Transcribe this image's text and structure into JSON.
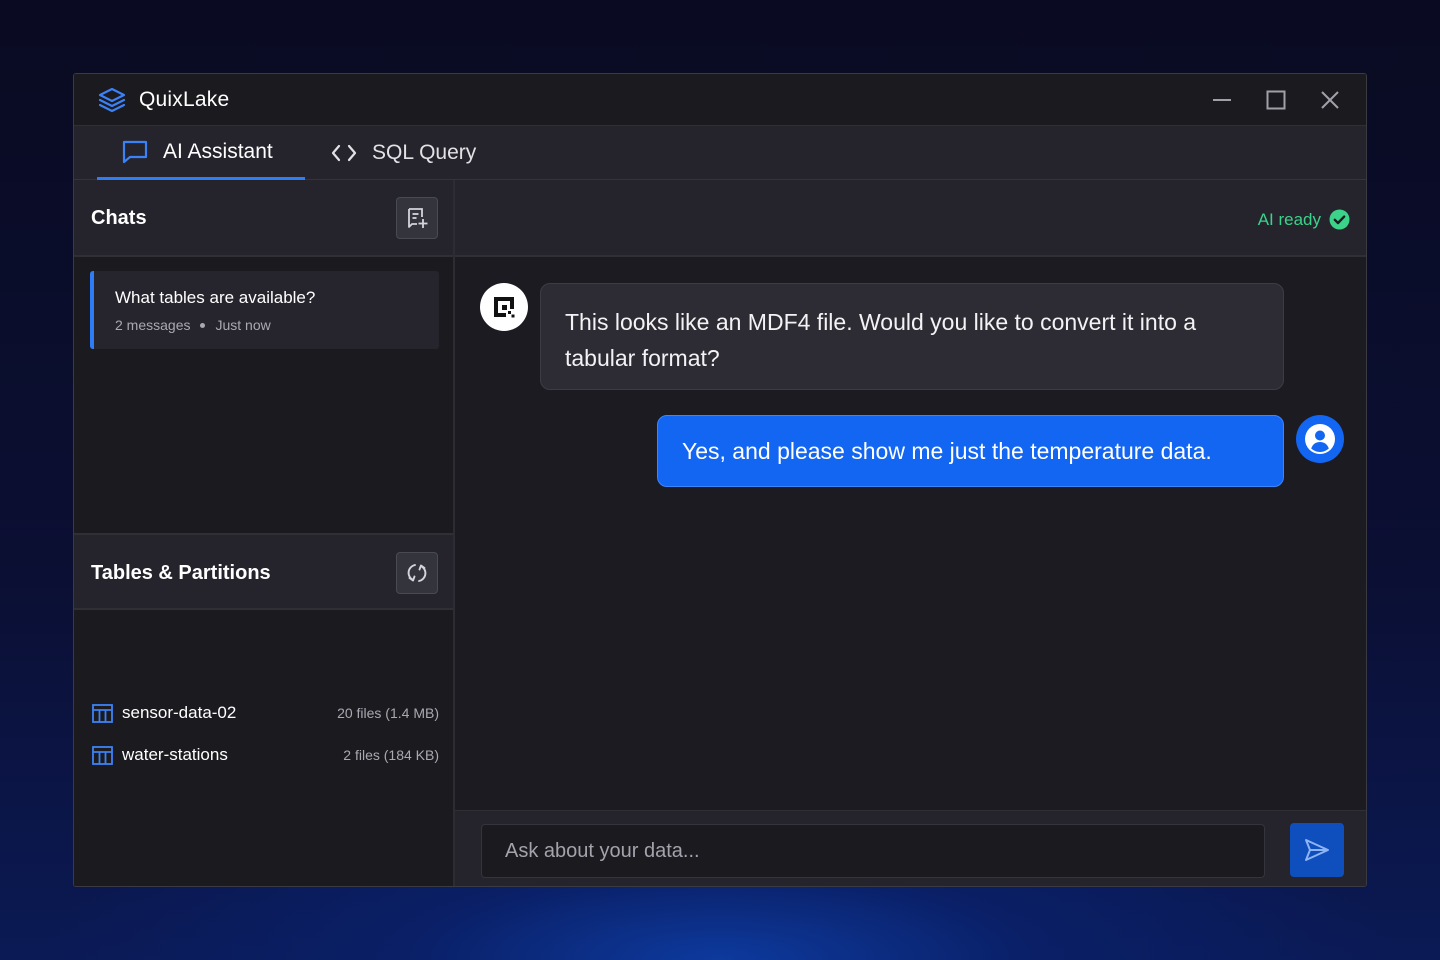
{
  "app": {
    "title": "QuixLake",
    "accent_color": "#2f7df6"
  },
  "tabs": [
    {
      "label": "AI Assistant",
      "icon": "chat-bubble-icon",
      "active": true
    },
    {
      "label": "SQL Query",
      "icon": "code-brackets-icon",
      "active": false
    }
  ],
  "chats": {
    "title": "Chats",
    "new_chat_icon": "new-chat-icon",
    "items": [
      {
        "title": "What tables are available?",
        "count": "2 messages",
        "time": "Just now"
      }
    ]
  },
  "tables": {
    "title": "Tables & Partitions",
    "refresh_icon": "refresh-icon",
    "items": [
      {
        "name": "sensor-data-02",
        "size": "20 files (1.4 MB)",
        "icon": "table-icon"
      },
      {
        "name": "water-stations",
        "size": "2 files (184 KB)",
        "icon": "table-icon"
      }
    ]
  },
  "status": {
    "text": "AI ready",
    "color": "#3bd28a",
    "icon": "check-circle-icon"
  },
  "messages": [
    {
      "role": "assistant",
      "text": "This looks like an MDF4 file. Would you like to convert it into a tabular format?"
    },
    {
      "role": "user",
      "text": "Yes, and please show me just the temperature data."
    }
  ],
  "composer": {
    "placeholder": "Ask about your data...",
    "value": "",
    "send_icon": "send-icon"
  }
}
